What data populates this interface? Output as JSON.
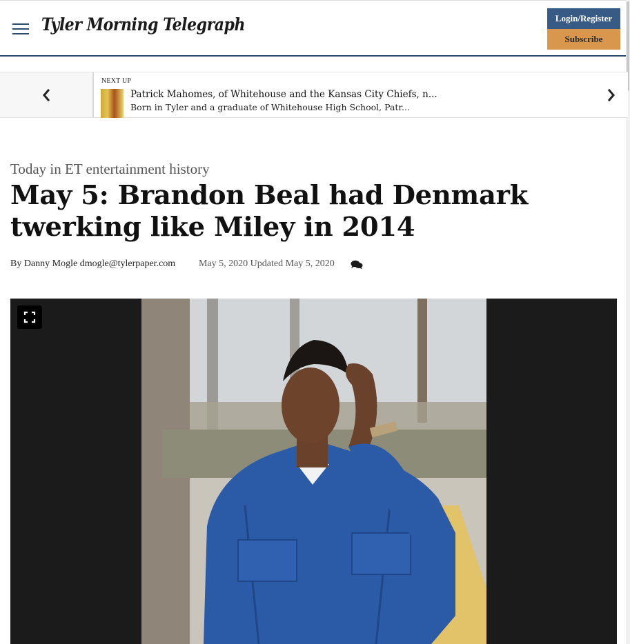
{
  "header": {
    "logo_text": "Tyler Morning Telegraph",
    "login_label": "Login/Register",
    "subscribe_label": "Subscribe",
    "menu_icon": "hamburger-icon"
  },
  "next_up": {
    "label": "NEXT UP",
    "title": "Patrick Mahomes, of Whitehouse and the Kansas City Chiefs, n...",
    "description": "Born in Tyler and a graduate of Whitehouse High School, Patr...",
    "prev_icon": "chevron-left-icon",
    "next_icon": "chevron-right-icon"
  },
  "article": {
    "kicker": "Today in ET entertainment history",
    "headline": "May 5: Brandon Beal had Denmark twerking like Miley in 2014",
    "byline": "By Danny Mogle dmogle@tylerpaper.com",
    "dates": "May 5, 2020 Updated May 5, 2020",
    "comments_icon": "comments-icon"
  },
  "photo": {
    "expand_icon": "expand-icon"
  },
  "colors": {
    "brand_blue": "#375b84",
    "subscribe_orange": "#d8974d",
    "header_rule": "#2c4a6b"
  }
}
